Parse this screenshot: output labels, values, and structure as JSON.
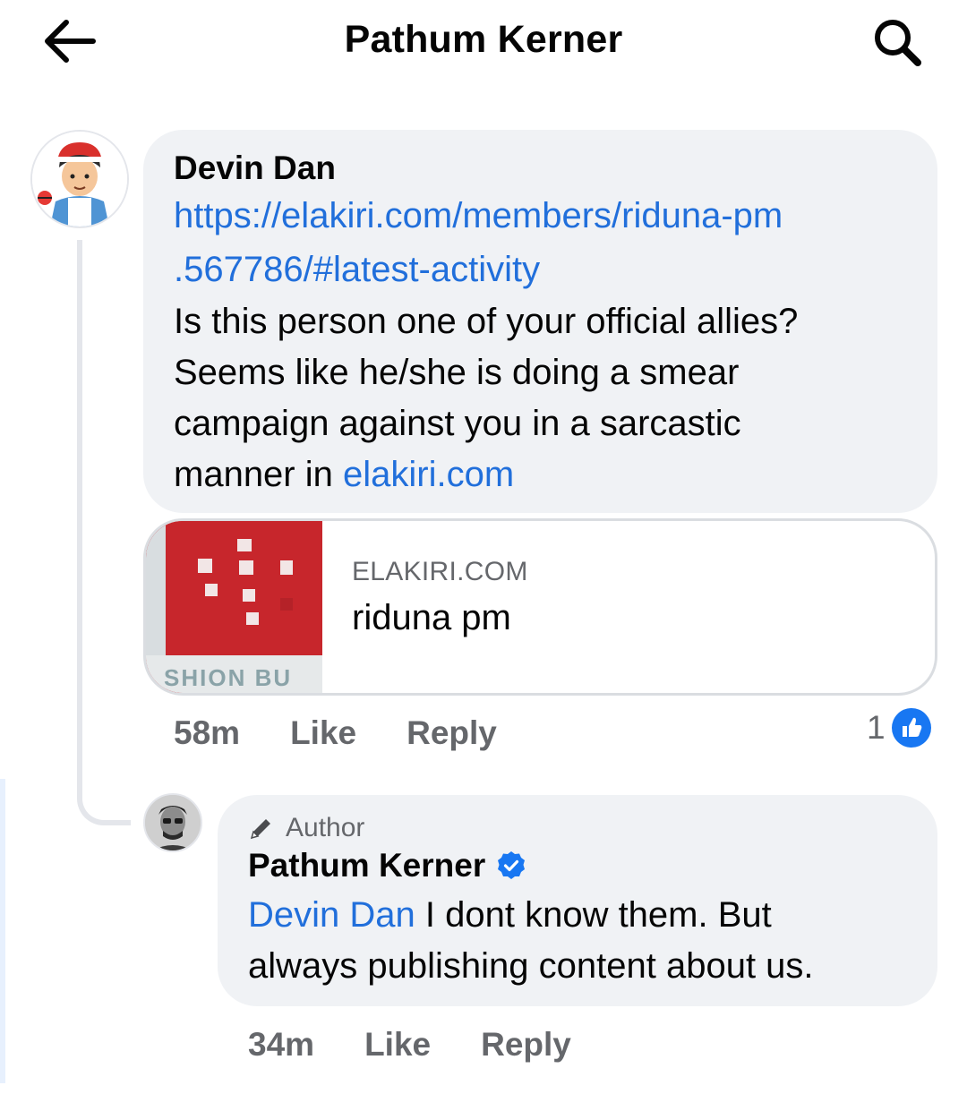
{
  "header": {
    "title": "Pathum Kerner",
    "back_icon": "arrow-left-icon",
    "search_icon": "search-icon"
  },
  "comment": {
    "author": "Devin Dan",
    "link_line1": "https://elakiri.com/members/riduna-pm",
    "link_line2": ".567786/#latest-activity",
    "text_line1": "Is this person one of your official allies?",
    "text_line2": "Seems like he/she is doing a smear",
    "text_line3": "campaign against you in a sarcastic",
    "text_line4_prefix": "manner in ",
    "text_line4_link": "elakiri.com",
    "preview": {
      "domain": "ELAKIRI.COM",
      "title": "riduna pm",
      "thumb_caption": "SHION BU"
    },
    "time": "58m",
    "like_label": "Like",
    "reply_label": "Reply",
    "reaction_count": "1",
    "reaction_icon": "like-reaction-icon"
  },
  "reply": {
    "author_tag": "Author",
    "author": "Pathum Kerner",
    "verified_icon": "verified-badge-icon",
    "mention": "Devin Dan",
    "text_line1": " I dont know them. But",
    "text_line2": "always publishing content about us.",
    "time": "34m",
    "like_label": "Like",
    "reply_label": "Reply"
  },
  "colors": {
    "link": "#216fdb",
    "bubble": "#f0f2f5",
    "muted": "#65676b",
    "verified": "#1877f2"
  }
}
